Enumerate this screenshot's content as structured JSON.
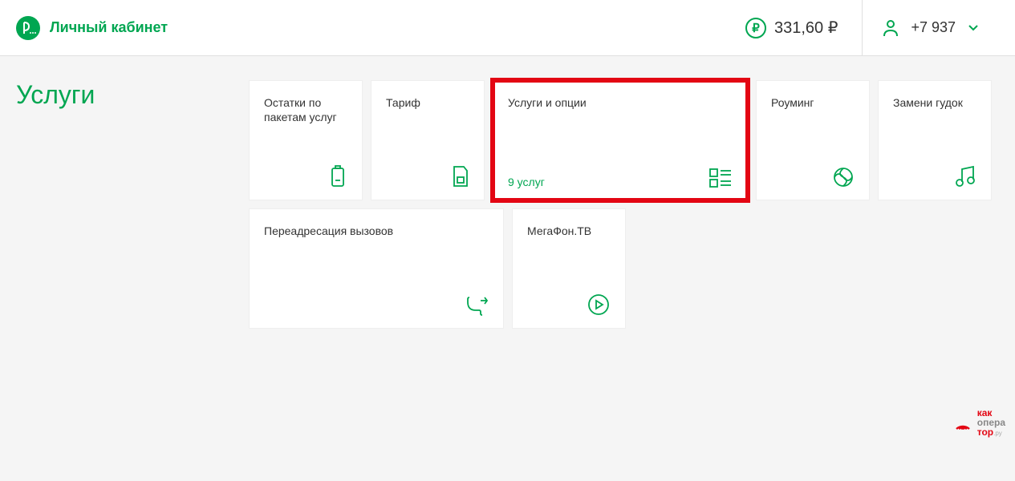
{
  "header": {
    "title": "Личный кабинет",
    "balance": "331,60 ₽",
    "phone": "+7 937"
  },
  "page": {
    "title": "Услуги"
  },
  "cards": [
    {
      "title": "Остатки по пакетам услуг",
      "extra": "",
      "icon": "battery",
      "size": "small",
      "highlight": false
    },
    {
      "title": "Тариф",
      "extra": "",
      "icon": "sim",
      "size": "small",
      "highlight": false
    },
    {
      "title": "Услуги и опции",
      "extra": "9 услуг",
      "icon": "list",
      "size": "wide",
      "highlight": true
    },
    {
      "title": "Роуминг",
      "extra": "",
      "icon": "globe",
      "size": "small",
      "highlight": false
    },
    {
      "title": "Замени гудок",
      "extra": "",
      "icon": "music",
      "size": "small",
      "highlight": false
    },
    {
      "title": "Переадресация вызовов",
      "extra": "",
      "icon": "forward",
      "size": "wide",
      "highlight": false
    },
    {
      "title": "МегаФон.ТВ",
      "extra": "",
      "icon": "play",
      "size": "small",
      "highlight": false
    }
  ],
  "watermark": {
    "l1": "как",
    "l2": "опера",
    "l3": "тор",
    "suffix": ".ру"
  }
}
